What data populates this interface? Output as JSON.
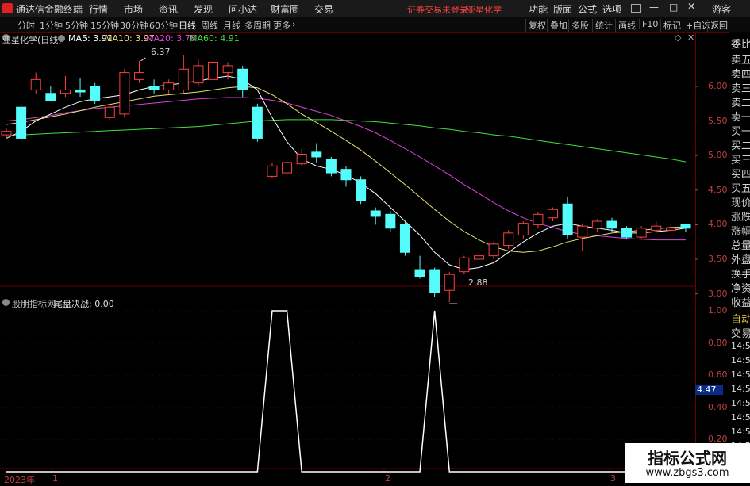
{
  "menubar": {
    "app_title": "通达信金融终端",
    "items": [
      "行情",
      "市场",
      "资讯",
      "发现",
      "问小达",
      "财富圈",
      "交易"
    ],
    "status_text": "证券交易未登录",
    "stock_name": "亚星化学",
    "right_items": [
      "功能",
      "版面",
      "公式",
      "选项"
    ],
    "guest": "游客"
  },
  "toolbar": {
    "periods": [
      "分时",
      "1分钟",
      "5分钟",
      "15分钟",
      "30分钟",
      "60分钟",
      "日线",
      "周线",
      "月线",
      "多周期",
      "更多"
    ],
    "selected_period": "日线",
    "right_buttons": [
      "复权",
      "叠加",
      "多股",
      "统计",
      "画线",
      "F10",
      "标记",
      "+自选",
      "返回"
    ]
  },
  "main_chart": {
    "title": "亚星化学(日线)",
    "ma_labels": [
      {
        "text": "MA5: 3.91",
        "color": "#ffffff"
      },
      {
        "text": "MA10: 3.97",
        "color": "#e8e070"
      },
      {
        "text": "MA20: 3.78",
        "color": "#e040e0"
      },
      {
        "text": "MA60: 4.91",
        "color": "#40e040"
      }
    ],
    "high_label": "6.37",
    "low_label": "2.88",
    "y_ticks": [
      "6.00",
      "5.50",
      "5.00",
      "4.50",
      "4.00",
      "3.50",
      "3.00"
    ],
    "y_values": [
      6.0,
      5.5,
      5.0,
      4.5,
      4.0,
      3.5,
      3.0
    ],
    "current_price_tag": "4.47"
  },
  "indicator": {
    "title": "股朋指标网",
    "name_value": "尾盘决战: 0.00",
    "y_ticks": [
      "1.00",
      "0.80",
      "0.60",
      "0.40",
      "0.20"
    ]
  },
  "time_axis": [
    "2023年",
    "1",
    "2",
    "3"
  ],
  "side_panel": {
    "items": [
      "委比",
      "卖五",
      "卖四",
      "卖三",
      "卖二",
      "卖一",
      "买一",
      "买二",
      "买三",
      "买四",
      "买五",
      "现价",
      "涨跌",
      "涨幅",
      "总量",
      "外盘",
      "换手",
      "净资",
      "收益"
    ],
    "items2": [
      "自动",
      "交易"
    ],
    "ticks": [
      "14:56",
      "14:56",
      "14:56",
      "14:56",
      "14:56",
      "14:56",
      "14:56",
      "14:56"
    ]
  },
  "watermark": {
    "line1": "指标公式网",
    "line2": "www.zbgs3.com"
  },
  "chart_data": {
    "type": "candlestick",
    "title": "亚星化学(日线)",
    "ylim": [
      2.8,
      6.6
    ],
    "candles": [
      {
        "o": 5.3,
        "c": 5.35,
        "h": 5.4,
        "l": 5.25
      },
      {
        "o": 5.7,
        "c": 5.25,
        "h": 5.75,
        "l": 5.2
      },
      {
        "o": 5.95,
        "c": 6.1,
        "h": 6.2,
        "l": 5.9
      },
      {
        "o": 5.9,
        "c": 5.8,
        "h": 6.0,
        "l": 5.78
      },
      {
        "o": 5.9,
        "c": 5.95,
        "h": 6.15,
        "l": 5.85
      },
      {
        "o": 5.95,
        "c": 5.92,
        "h": 6.12,
        "l": 5.85
      },
      {
        "o": 6.0,
        "c": 5.8,
        "h": 6.05,
        "l": 5.75
      },
      {
        "o": 5.55,
        "c": 5.7,
        "h": 5.75,
        "l": 5.5
      },
      {
        "o": 5.6,
        "c": 6.2,
        "h": 6.25,
        "l": 5.55
      },
      {
        "o": 6.1,
        "c": 6.2,
        "h": 6.37,
        "l": 6.05
      },
      {
        "o": 6.0,
        "c": 5.95,
        "h": 6.1,
        "l": 5.9
      },
      {
        "o": 5.95,
        "c": 6.05,
        "h": 6.1,
        "l": 5.9
      },
      {
        "o": 5.95,
        "c": 6.25,
        "h": 6.45,
        "l": 5.9
      },
      {
        "o": 6.05,
        "c": 6.3,
        "h": 6.4,
        "l": 6.0
      },
      {
        "o": 6.1,
        "c": 6.35,
        "h": 6.5,
        "l": 6.05
      },
      {
        "o": 6.2,
        "c": 6.3,
        "h": 6.35,
        "l": 6.1
      },
      {
        "o": 6.25,
        "c": 5.95,
        "h": 6.3,
        "l": 5.85
      },
      {
        "o": 5.7,
        "c": 5.25,
        "h": 5.75,
        "l": 5.2
      },
      {
        "o": 4.7,
        "c": 4.85,
        "h": 4.9,
        "l": 4.68
      },
      {
        "o": 4.75,
        "c": 4.9,
        "h": 4.95,
        "l": 4.7
      },
      {
        "o": 4.88,
        "c": 5.02,
        "h": 5.1,
        "l": 4.85
      },
      {
        "o": 5.05,
        "c": 4.98,
        "h": 5.18,
        "l": 4.9
      },
      {
        "o": 4.95,
        "c": 4.75,
        "h": 4.98,
        "l": 4.7
      },
      {
        "o": 4.8,
        "c": 4.65,
        "h": 4.85,
        "l": 4.55
      },
      {
        "o": 4.65,
        "c": 4.35,
        "h": 4.7,
        "l": 4.3
      },
      {
        "o": 4.2,
        "c": 4.12,
        "h": 4.25,
        "l": 4.0
      },
      {
        "o": 4.15,
        "c": 3.95,
        "h": 4.2,
        "l": 3.9
      },
      {
        "o": 4.0,
        "c": 3.6,
        "h": 4.05,
        "l": 3.55
      },
      {
        "o": 3.35,
        "c": 3.25,
        "h": 3.55,
        "l": 3.22
      },
      {
        "o": 3.35,
        "c": 3.02,
        "h": 3.38,
        "l": 2.95
      },
      {
        "o": 3.05,
        "c": 3.28,
        "h": 3.32,
        "l": 2.88
      },
      {
        "o": 3.32,
        "c": 3.52,
        "h": 3.55,
        "l": 3.28
      },
      {
        "o": 3.5,
        "c": 3.55,
        "h": 3.58,
        "l": 3.45
      },
      {
        "o": 3.55,
        "c": 3.72,
        "h": 3.75,
        "l": 3.5
      },
      {
        "o": 3.7,
        "c": 3.88,
        "h": 3.92,
        "l": 3.65
      },
      {
        "o": 3.85,
        "c": 4.02,
        "h": 4.05,
        "l": 3.8
      },
      {
        "o": 4.0,
        "c": 4.15,
        "h": 4.18,
        "l": 3.95
      },
      {
        "o": 4.1,
        "c": 4.22,
        "h": 4.25,
        "l": 4.05
      },
      {
        "o": 4.3,
        "c": 3.85,
        "h": 4.4,
        "l": 3.8
      },
      {
        "o": 3.82,
        "c": 3.98,
        "h": 4.02,
        "l": 3.62
      },
      {
        "o": 3.95,
        "c": 4.05,
        "h": 4.08,
        "l": 3.9
      },
      {
        "o": 4.05,
        "c": 3.95,
        "h": 4.1,
        "l": 3.9
      },
      {
        "o": 3.95,
        "c": 3.82,
        "h": 3.98,
        "l": 3.8
      },
      {
        "o": 3.82,
        "c": 3.95,
        "h": 3.98,
        "l": 3.8
      },
      {
        "o": 3.92,
        "c": 3.98,
        "h": 4.05,
        "l": 3.88
      },
      {
        "o": 3.92,
        "c": 3.95,
        "h": 4.02,
        "l": 3.9
      },
      {
        "o": 4.0,
        "c": 3.95,
        "h": 4.0,
        "l": 3.9
      }
    ],
    "ma5": [
      5.25,
      5.35,
      5.5,
      5.6,
      5.7,
      5.78,
      5.82,
      5.85,
      5.88,
      5.95,
      6.0,
      6.02,
      6.05,
      6.08,
      6.12,
      6.15,
      6.1,
      5.95,
      5.55,
      5.2,
      4.95,
      4.85,
      4.8,
      4.72,
      4.6,
      4.45,
      4.25,
      4.05,
      3.85,
      3.6,
      3.42,
      3.35,
      3.38,
      3.45,
      3.6,
      3.75,
      3.88,
      3.98,
      4.02,
      3.98,
      3.95,
      3.92,
      3.88,
      3.88,
      3.9,
      3.92,
      3.95
    ],
    "ma10": [
      5.45,
      5.48,
      5.52,
      5.56,
      5.6,
      5.65,
      5.7,
      5.74,
      5.78,
      5.82,
      5.86,
      5.88,
      5.9,
      5.92,
      5.95,
      5.98,
      6.0,
      5.98,
      5.88,
      5.75,
      5.6,
      5.48,
      5.35,
      5.22,
      5.08,
      4.92,
      4.75,
      4.58,
      4.4,
      4.22,
      4.05,
      3.9,
      3.78,
      3.68,
      3.62,
      3.6,
      3.62,
      3.68,
      3.75,
      3.8,
      3.84,
      3.88,
      3.9,
      3.92,
      3.94,
      3.96,
      3.97
    ],
    "ma20": [
      5.5,
      5.52,
      5.55,
      5.58,
      5.62,
      5.65,
      5.68,
      5.7,
      5.72,
      5.74,
      5.76,
      5.78,
      5.8,
      5.82,
      5.83,
      5.84,
      5.84,
      5.83,
      5.8,
      5.76,
      5.7,
      5.64,
      5.58,
      5.5,
      5.42,
      5.33,
      5.22,
      5.1,
      4.98,
      4.85,
      4.72,
      4.58,
      4.45,
      4.32,
      4.2,
      4.1,
      4.02,
      3.96,
      3.9,
      3.86,
      3.84,
      3.82,
      3.8,
      3.79,
      3.78,
      3.78,
      3.78
    ],
    "ma60": [
      5.28,
      5.3,
      5.31,
      5.32,
      5.33,
      5.34,
      5.35,
      5.36,
      5.37,
      5.38,
      5.39,
      5.4,
      5.41,
      5.42,
      5.44,
      5.46,
      5.48,
      5.5,
      5.51,
      5.52,
      5.52,
      5.52,
      5.52,
      5.51,
      5.5,
      5.49,
      5.47,
      5.45,
      5.43,
      5.4,
      5.38,
      5.35,
      5.33,
      5.3,
      5.28,
      5.25,
      5.22,
      5.19,
      5.16,
      5.13,
      5.1,
      5.07,
      5.04,
      5.01,
      4.98,
      4.95,
      4.91
    ],
    "indicator": {
      "name": "尾盘决战",
      "ylim": [
        0,
        1.05
      ],
      "points": [
        [
          0,
          0
        ],
        [
          17,
          0
        ],
        [
          18,
          1
        ],
        [
          19,
          1
        ],
        [
          20,
          0
        ],
        [
          28,
          0
        ],
        [
          29,
          1
        ],
        [
          30,
          0
        ],
        [
          46,
          0
        ]
      ]
    }
  }
}
